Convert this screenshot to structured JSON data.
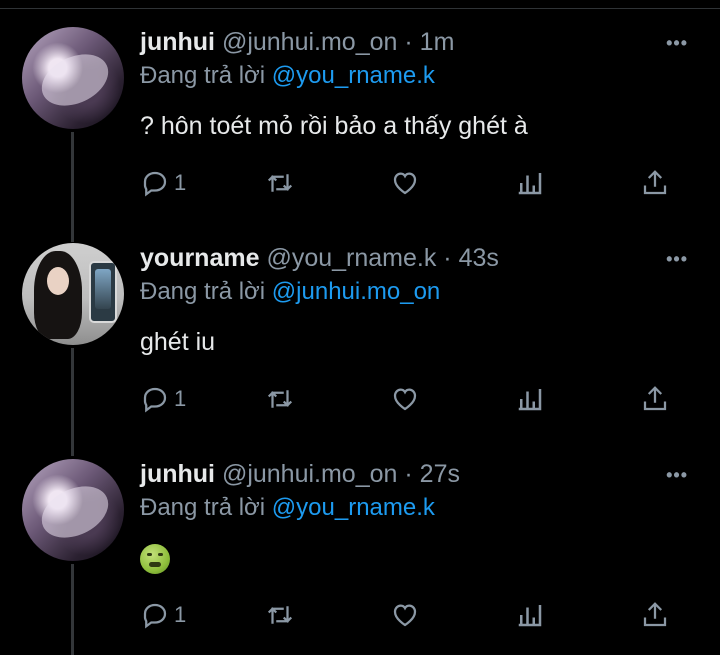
{
  "colors": {
    "background": "#000000",
    "text": "#e7e9ea",
    "secondary": "#8b98a5",
    "mention": "#1d9bf0",
    "thread_line": "#333639"
  },
  "replying_prefix": "Đang trả lời",
  "tweets": [
    {
      "name": "junhui",
      "handle": "@junhui.mo_on",
      "time": "· 1m",
      "reply_to": "@you_rname.k",
      "text": "? hôn toét mỏ rồi bảo a thấy ghét à",
      "reply_count": "1",
      "more": "•••"
    },
    {
      "name": "yourname",
      "handle": "@you_rname.k",
      "time": "· 43s",
      "reply_to": "@junhui.mo_on",
      "text": "ghét iu",
      "reply_count": "1",
      "more": "•••"
    },
    {
      "name": "junhui",
      "handle": "@junhui.mo_on",
      "time": "· 27s",
      "reply_to": "@you_rname.k",
      "emoji": "nauseated-face-emoji",
      "reply_count": "1",
      "more": "•••"
    }
  ],
  "icons": [
    "reply-icon",
    "retweet-icon",
    "like-icon",
    "views-icon",
    "share-icon",
    "more-icon"
  ]
}
